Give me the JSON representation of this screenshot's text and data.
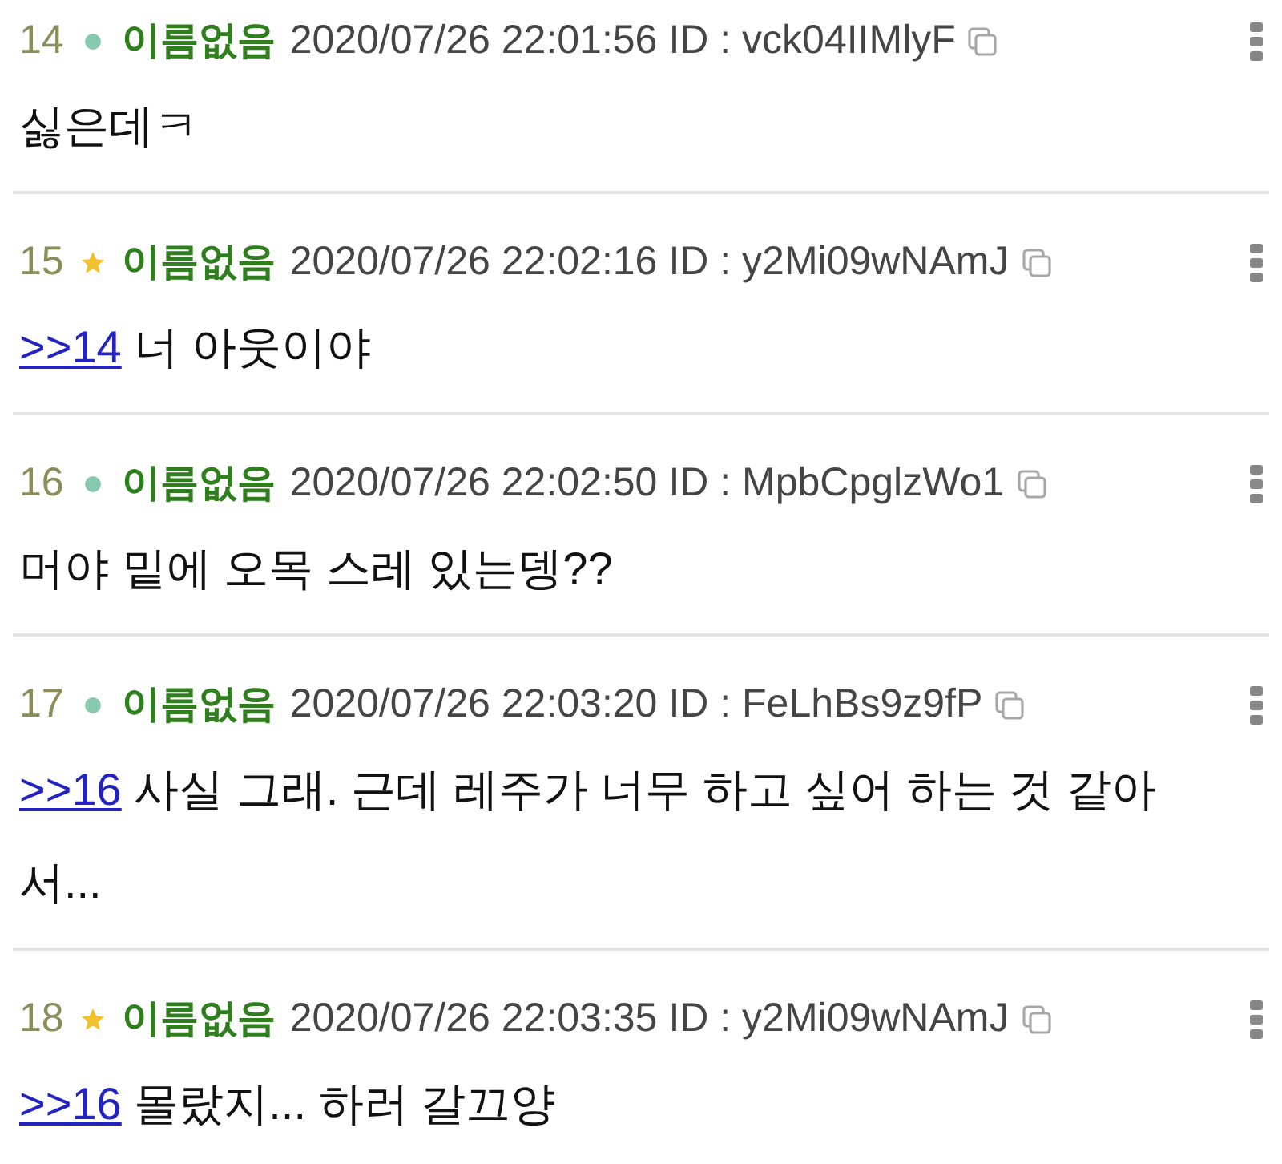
{
  "posts": [
    {
      "number": "14",
      "starred": false,
      "name": "이름없음",
      "datetime": "2020/07/26 22:01:56",
      "id": "ID : vck04IIMlyF",
      "text": "싫은데ㅋ"
    },
    {
      "number": "15",
      "starred": true,
      "name": "이름없음",
      "datetime": "2020/07/26 22:02:16",
      "id": "ID : y2Mi09wNAmJ",
      "reply_to": ">>14",
      "text": "너 아웃이야"
    },
    {
      "number": "16",
      "starred": false,
      "name": "이름없음",
      "datetime": "2020/07/26 22:02:50",
      "id": "ID : MpbCpglzWo1",
      "text": "머야 밑에 오목 스레 있는뎅??"
    },
    {
      "number": "17",
      "starred": false,
      "name": "이름없음",
      "datetime": "2020/07/26 22:03:20",
      "id": "ID : FeLhBs9z9fP",
      "reply_to": ">>16",
      "text": "사실 그래. 근데 레주가 너무 하고 싶어 하는 것 같아서..."
    },
    {
      "number": "18",
      "starred": true,
      "name": "이름없음",
      "datetime": "2020/07/26 22:03:35",
      "id": "ID : y2Mi09wNAmJ",
      "reply_to": ">>16",
      "text": "몰랐지... 하러 갈끄양"
    }
  ]
}
